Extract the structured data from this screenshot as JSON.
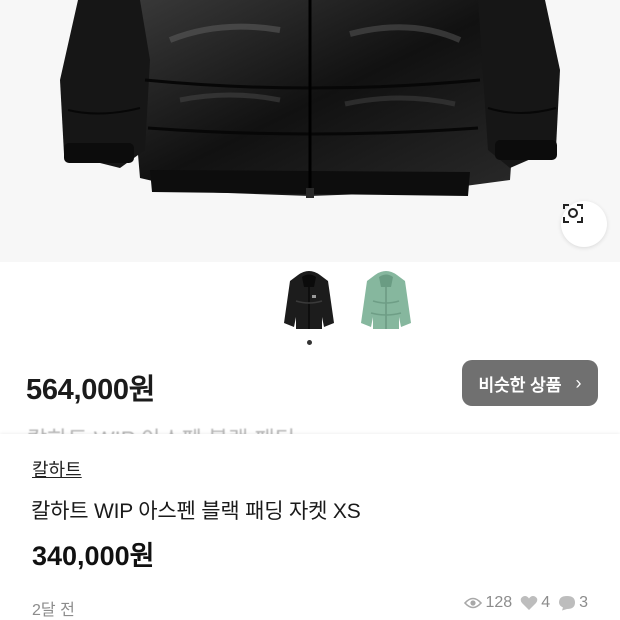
{
  "gallery": {
    "lens_icon": "image-search-icon",
    "thumbnails": [
      {
        "name": "thumbnail-black-jacket",
        "color": "#1c1c1c"
      },
      {
        "name": "thumbnail-green-jacket",
        "color": "#86b79e"
      }
    ],
    "active_index": 0
  },
  "background_listing": {
    "price": "564,000원",
    "similar_button_label": "비슷한 상품",
    "title_fragment": "칼하트 WIP 아스펜 블랙 패딩"
  },
  "product": {
    "brand": "칼하트",
    "title": "칼하트 WIP 아스펜 블랙 패딩 자켓 XS",
    "price": "340,000원",
    "posted": "2달 전",
    "views": "128",
    "likes": "4",
    "chats": "3"
  },
  "colors": {
    "jacket_black": "#161616",
    "jacket_green": "#86b79e",
    "button_gray": "#646464",
    "meta_gray": "#8c8c8c"
  }
}
